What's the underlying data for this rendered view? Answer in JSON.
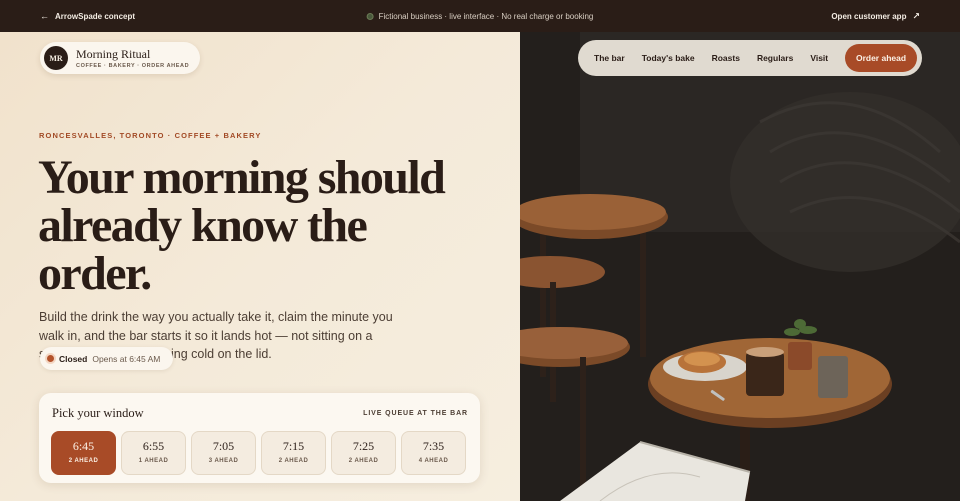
{
  "topbar": {
    "back_label": "ArrowSpade concept",
    "notice": "Fictional business · live interface · No real charge or booking",
    "open_app_label": "Open customer app"
  },
  "brand": {
    "monogram": "MR",
    "name": "Morning Ritual",
    "tagline": "COFFEE · BAKERY · ORDER AHEAD"
  },
  "nav": {
    "items": [
      {
        "label": "The bar"
      },
      {
        "label": "Today's bake"
      },
      {
        "label": "Roasts"
      },
      {
        "label": "Regulars"
      },
      {
        "label": "Visit"
      }
    ],
    "cta_label": "Order ahead"
  },
  "hero": {
    "eyebrow": "RONCESVALLES, TORONTO · COFFEE + BAKERY",
    "headline_lines": [
      "Your morning should",
      "already know the",
      "order."
    ],
    "body": "Build the drink the way you actually take it, claim the minute you walk in, and the bar starts it so it lands hot — not sitting on a shelf with your name going cold on the lid."
  },
  "status": {
    "state": "Closed",
    "opens": "Opens at 6:45 AM"
  },
  "pickup": {
    "title": "Pick your window",
    "queue_label": "LIVE QUEUE AT THE BAR",
    "slots": [
      {
        "time": "6:45",
        "ahead": "2 AHEAD",
        "selected": true
      },
      {
        "time": "6:55",
        "ahead": "1 AHEAD",
        "selected": false
      },
      {
        "time": "7:05",
        "ahead": "3 AHEAD",
        "selected": false
      },
      {
        "time": "7:15",
        "ahead": "2 AHEAD",
        "selected": false
      },
      {
        "time": "7:25",
        "ahead": "2 AHEAD",
        "selected": false
      },
      {
        "time": "7:35",
        "ahead": "4 AHEAD",
        "selected": false
      }
    ]
  },
  "colors": {
    "topbar_bg": "#2a1d17",
    "accent": "#a84b27",
    "ink": "#2a1d17",
    "cream": "#f3e8d6"
  },
  "icons": {
    "back": "arrow-left-icon",
    "open_app": "arrow-up-right-icon",
    "live": "live-dot-icon",
    "status": "status-dot-icon"
  }
}
